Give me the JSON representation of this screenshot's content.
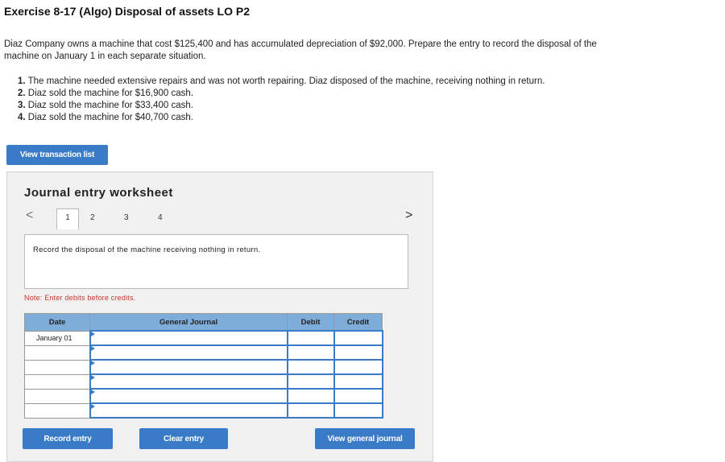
{
  "header": {
    "title": "Exercise 8-17 (Algo) Disposal of assets LO P2",
    "intro": "Diaz Company owns a machine that cost $125,400 and has accumulated depreciation of $92,000. Prepare the entry to record the disposal of the machine on January 1 in each separate situation."
  },
  "situations": [
    {
      "num": "1.",
      "text": "The machine needed extensive repairs and was not worth repairing. Diaz disposed of the machine, receiving nothing in return."
    },
    {
      "num": "2.",
      "text": "Diaz sold the machine for $16,900 cash."
    },
    {
      "num": "3.",
      "text": "Diaz sold the machine for $33,400 cash."
    },
    {
      "num": "4.",
      "text": "Diaz sold the machine for $40,700 cash."
    }
  ],
  "buttons": {
    "view_transaction": "View transaction list",
    "record_entry": "Record entry",
    "clear_entry": "Clear entry",
    "view_general_journal": "View general journal"
  },
  "worksheet": {
    "title": "Journal entry worksheet",
    "prev_glyph": "<",
    "next_glyph": ">",
    "tabs": [
      "1",
      "2",
      "3",
      "4"
    ],
    "active_tab": "1",
    "instruction": "Record the disposal of the machine receiving nothing in return.",
    "note": "Note: Enter debits before credits."
  },
  "journal": {
    "headers": {
      "date": "Date",
      "general_journal": "General Journal",
      "debit": "Debit",
      "credit": "Credit"
    },
    "rows": [
      {
        "date": "January 01",
        "account": "",
        "debit": "",
        "credit": ""
      },
      {
        "date": "",
        "account": "",
        "debit": "",
        "credit": ""
      },
      {
        "date": "",
        "account": "",
        "debit": "",
        "credit": ""
      },
      {
        "date": "",
        "account": "",
        "debit": "",
        "credit": ""
      },
      {
        "date": "",
        "account": "",
        "debit": "",
        "credit": ""
      },
      {
        "date": "",
        "account": "",
        "debit": "",
        "credit": ""
      }
    ]
  },
  "colors": {
    "accent": "#3a7bc8",
    "header_fill": "#7fadd9",
    "note_red": "#c0392b"
  }
}
